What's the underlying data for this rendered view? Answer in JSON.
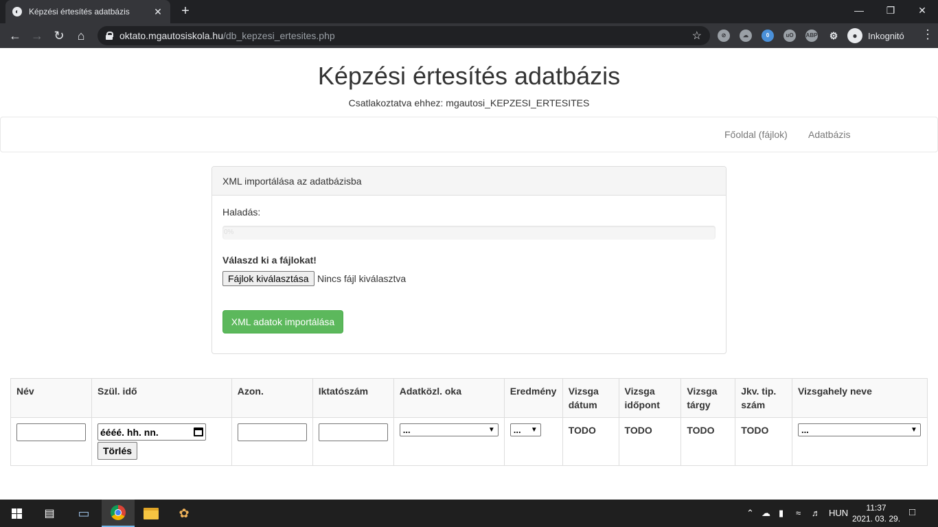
{
  "browser": {
    "tab_title": "Képzési értesítés adatbázis",
    "tab_close": "✕",
    "new_tab": "+",
    "url_host": "oktato.mgautosiskola.hu",
    "url_path": "/db_kepzesi_ertesites.php",
    "profile_label": "Inkognitó",
    "ext_badge": "0"
  },
  "header": {
    "title": "Képzési értesítés adatbázis",
    "subtitle": "Csatlakoztatva ehhez: mgautosi_KEPZESI_ERTESITES"
  },
  "nav": {
    "home": "Főoldal (fájlok)",
    "database": "Adatbázis"
  },
  "import_panel": {
    "heading": "XML importálása az adatbázisba",
    "progress_label": "Haladás:",
    "progress_text": "0%",
    "progress_fraction": 0,
    "files_label": "Válaszd ki a fájlokat!",
    "file_button": "Fájlok kiválasztása",
    "file_status": "Nincs fájl kiválasztva",
    "import_button": "XML adatok importálása"
  },
  "table": {
    "headers": {
      "nev": "Név",
      "szul": "Szül. idő",
      "azon": "Azon.",
      "iktato": "Iktatószám",
      "adatkozl": "Adatközl. oka",
      "eredmeny": "Eredmény",
      "vdatum": "Vizsga dátum",
      "vidopont": "Vizsga időpont",
      "vtargy": "Vizsga tárgy",
      "jkv": "Jkv. tip. szám",
      "vhely": "Vizsgahely neve"
    },
    "filters": {
      "date_placeholder": "éééé. hh. nn.",
      "clear_button": "Törlés",
      "adatkozl_selected": "...",
      "eredmeny_selected": "...",
      "vhely_selected": "...",
      "todo": "TODO"
    }
  },
  "taskbar": {
    "lang": "HUN",
    "time": "11:37",
    "date": "2021. 03. 29."
  }
}
